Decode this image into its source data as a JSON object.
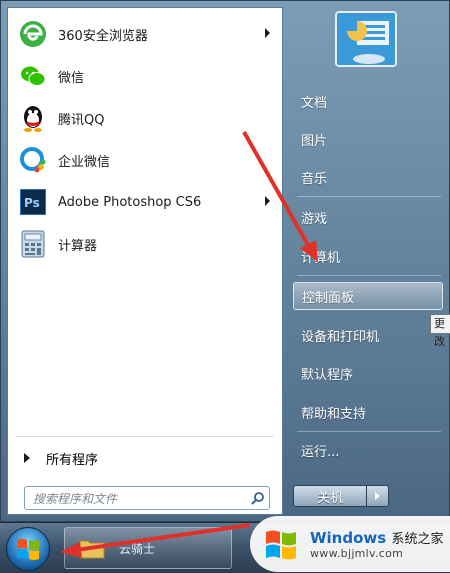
{
  "start_menu": {
    "pinned_apps": [
      {
        "label": "360安全浏览器",
        "icon": "browser-360-icon",
        "has_submenu": true
      },
      {
        "label": "微信",
        "icon": "wechat-icon",
        "has_submenu": false
      },
      {
        "label": "腾讯QQ",
        "icon": "qq-penguin-icon",
        "has_submenu": false
      },
      {
        "label": "企业微信",
        "icon": "wecom-icon",
        "has_submenu": false
      },
      {
        "label": "Adobe Photoshop CS6",
        "icon": "photoshop-icon",
        "has_submenu": true
      },
      {
        "label": "计算器",
        "icon": "calculator-icon",
        "has_submenu": false
      }
    ],
    "all_programs_label": "所有程序",
    "search_placeholder": "搜索程序和文件",
    "right_items": [
      "文档",
      "图片",
      "音乐",
      "游戏",
      "计算机",
      "控制面板",
      "设备和打印机",
      "默认程序",
      "帮助和支持",
      "运行..."
    ],
    "highlighted_item": "控制面板",
    "tooltip_text": "更改",
    "shutdown_label": "关机"
  },
  "taskbar": {
    "app_label": "云骑士"
  },
  "watermark": {
    "brand": "Windows",
    "subtitle": "系统之家",
    "url": "www.bjjmlv.com"
  },
  "colors": {
    "annotation_red": "#e0302a",
    "start_menu_blue": "#6d8ea9"
  }
}
